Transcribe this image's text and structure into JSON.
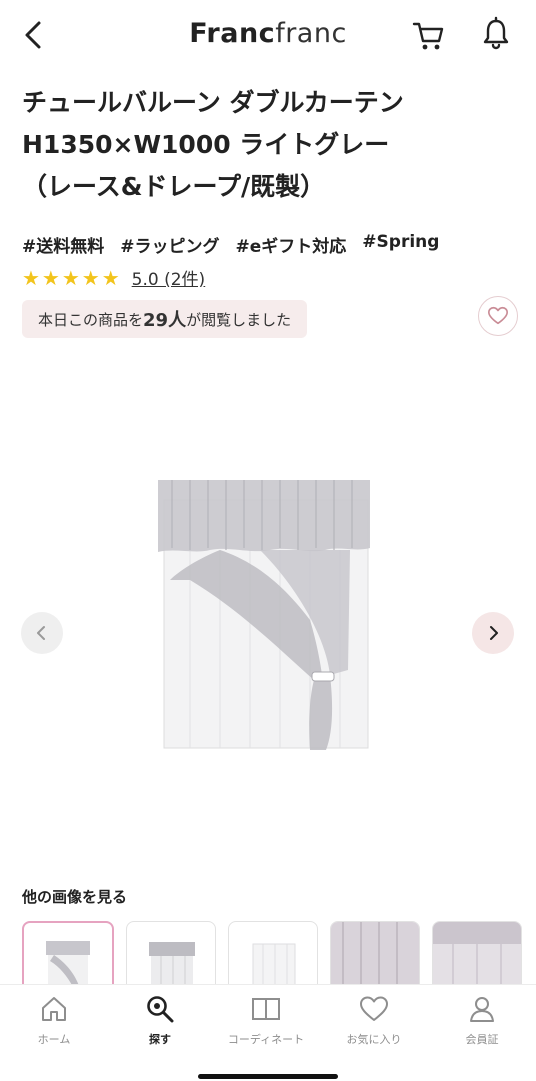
{
  "header": {
    "logo_bold": "Franc",
    "logo_light": "franc",
    "icons": [
      "chevron-left-icon",
      "cart-icon",
      "bell-icon"
    ]
  },
  "product": {
    "title_line1": "チュールバルーン ダブルカーテン",
    "title_line2": "H1350×W1000 ライトグレー",
    "title_line3": "（レース&ドレープ/既製）",
    "tags": [
      "#送料無料",
      "#ラッピング",
      "#eギフト対応",
      "#Spring"
    ],
    "stars": "★★★★★",
    "rating_text": "5.0 (2件)",
    "views_prefix": "本日この商品を",
    "views_count": "29人",
    "views_suffix": "が閲覧しました"
  },
  "gallery": {
    "section_label": "他の画像を見る",
    "thumbnail_count": 5,
    "active_index": 0
  },
  "tabbar": {
    "items": [
      {
        "label": "ホーム",
        "icon": "home-icon"
      },
      {
        "label": "探す",
        "icon": "search-icon"
      },
      {
        "label": "コーディネート",
        "icon": "book-icon"
      },
      {
        "label": "お気に入り",
        "icon": "heart-icon"
      },
      {
        "label": "会員証",
        "icon": "member-icon"
      }
    ],
    "active_index": 1
  },
  "colors": {
    "text": "#222222",
    "star": "#f2c41c",
    "badge_bg": "#f6ecec",
    "thumb_active_border": "#e6a3c0",
    "tab_inactive": "#8e8e8e"
  }
}
